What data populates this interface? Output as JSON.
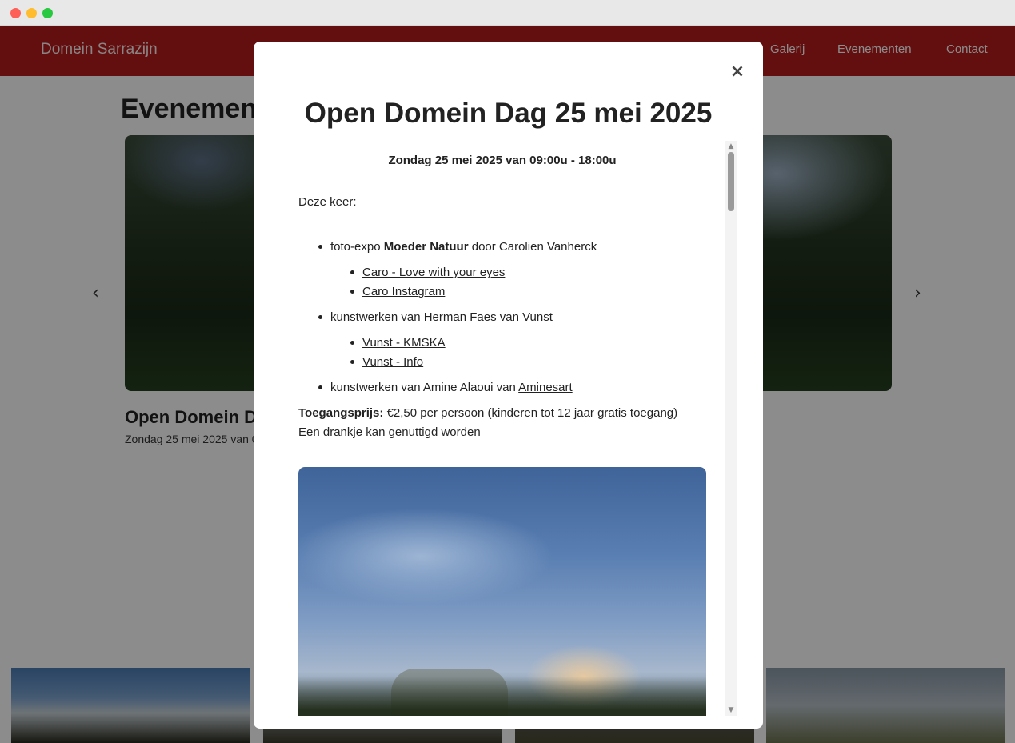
{
  "site": {
    "brand": "Domein Sarrazijn",
    "nav": {
      "galerij": "Galerij",
      "evenementen": "Evenementen",
      "contact": "Contact"
    }
  },
  "events_section": {
    "title": "Evenementen",
    "card_title": "Open Domein Dag 25 mei 2025",
    "card_date": "Zondag 25 mei 2025 van 09:00u - 18:00u",
    "prev_icon": "chevron-left-icon",
    "next_icon": "chevron-right-icon"
  },
  "modal": {
    "close_label": "×",
    "title": "Open Domein Dag 25 mei 2025",
    "date_line": "Zondag 25 mei 2025 van 09:00u - 18:00u",
    "intro": "Deze keer:",
    "items": [
      {
        "prefix": "foto-expo ",
        "bold": "Moeder Natuur",
        "suffix": " door Carolien Vanherck",
        "links": [
          "Caro - Love with your eyes",
          "Caro Instagram"
        ]
      },
      {
        "prefix": "kunstwerken van Herman Faes van Vunst",
        "links": [
          "Vunst - KMSKA",
          "Vunst - Info"
        ]
      },
      {
        "prefix": "kunstwerken van Amine Alaoui van ",
        "inline_link": "Aminesart"
      }
    ],
    "price_label": "Toegangsprijs:",
    "price_text": " €2,50 per persoon (kinderen tot 12 jaar gratis toegang)",
    "drink_text": "Een drankje kan genuttigd worden"
  }
}
